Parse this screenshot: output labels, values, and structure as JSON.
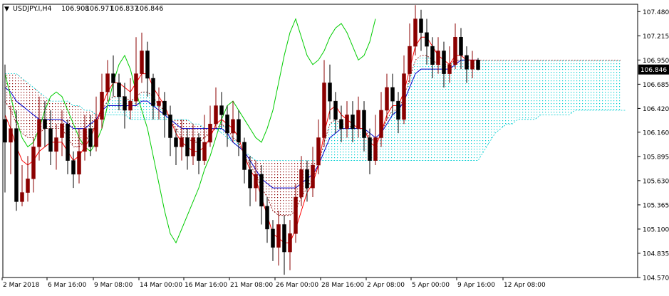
{
  "header": {
    "symbol": "USDJPY.I,H4",
    "open": "106.908",
    "high": "106.971",
    "low": "106.837",
    "close": "106.846"
  },
  "chart_data": {
    "type": "candlestick",
    "title": "USDJPY.I,H4",
    "ylim": [
      104.57,
      107.56
    ],
    "y_ticks": [
      "107.480",
      "107.215",
      "106.950",
      "106.685",
      "106.420",
      "106.160",
      "105.895",
      "105.630",
      "105.365",
      "105.100",
      "104.835",
      "104.570"
    ],
    "x_ticks": [
      "2 Mar 2018",
      "6 Mar 16:00",
      "9 Mar 08:00",
      "14 Mar 00:00",
      "16 Mar 16:00",
      "21 Mar 08:00",
      "26 Mar 00:00",
      "28 Mar 16:00",
      "2 Apr 08:00",
      "5 Apr 00:00",
      "9 Apr 16:00",
      "12 Apr 08:00"
    ],
    "current_price": "106.846",
    "colors": {
      "bull": "#8b0000",
      "bear": "#000000",
      "tenkan": "#ff0000",
      "kijun": "#0000cd",
      "chikou": "#00cc00",
      "kumo_bear": "#8b0000",
      "kumo_bull": "#00ced1"
    },
    "candles": [
      [
        106.3,
        106.05,
        106.9,
        105.5
      ],
      [
        106.05,
        106.2,
        106.45,
        105.7
      ],
      [
        106.2,
        105.4,
        106.4,
        105.3
      ],
      [
        105.4,
        105.5,
        105.8,
        105.35
      ],
      [
        105.5,
        105.65,
        105.9,
        105.4
      ],
      [
        105.65,
        106.0,
        106.1,
        105.5
      ],
      [
        106.0,
        106.3,
        106.55,
        105.85
      ],
      [
        106.3,
        106.2,
        106.5,
        106.0
      ],
      [
        106.2,
        105.95,
        106.4,
        105.8
      ],
      [
        105.95,
        106.1,
        106.25,
        105.75
      ],
      [
        106.1,
        106.25,
        106.4,
        105.9
      ],
      [
        106.25,
        105.85,
        106.3,
        105.7
      ],
      [
        105.85,
        105.7,
        105.95,
        105.55
      ],
      [
        105.7,
        105.95,
        106.2,
        105.6
      ],
      [
        105.95,
        106.2,
        106.35,
        105.85
      ],
      [
        106.2,
        106.0,
        106.35,
        105.9
      ],
      [
        106.0,
        106.3,
        106.55,
        105.95
      ],
      [
        106.3,
        106.6,
        106.8,
        106.2
      ],
      [
        106.6,
        106.8,
        106.95,
        106.5
      ],
      [
        106.8,
        106.7,
        107.0,
        106.55
      ],
      [
        106.7,
        106.55,
        106.8,
        106.4
      ],
      [
        106.55,
        106.4,
        106.7,
        106.2
      ],
      [
        106.4,
        106.5,
        106.75,
        106.3
      ],
      [
        106.5,
        106.8,
        107.2,
        106.45
      ],
      [
        106.8,
        107.05,
        107.25,
        106.7
      ],
      [
        107.05,
        106.75,
        107.15,
        106.55
      ],
      [
        106.75,
        106.45,
        106.8,
        106.3
      ],
      [
        106.45,
        106.5,
        106.65,
        106.3
      ],
      [
        106.5,
        106.35,
        106.6,
        106.1
      ],
      [
        106.35,
        106.1,
        106.45,
        105.9
      ],
      [
        106.1,
        106.0,
        106.2,
        105.8
      ],
      [
        106.0,
        106.1,
        106.3,
        105.85
      ],
      [
        106.1,
        105.9,
        106.2,
        105.75
      ],
      [
        105.9,
        106.1,
        106.25,
        105.8
      ],
      [
        106.1,
        105.85,
        106.15,
        105.7
      ],
      [
        105.85,
        106.05,
        106.35,
        105.8
      ],
      [
        106.05,
        106.25,
        106.45,
        106.0
      ],
      [
        106.25,
        106.45,
        106.65,
        106.2
      ],
      [
        106.45,
        106.35,
        106.6,
        106.2
      ],
      [
        106.35,
        106.15,
        106.45,
        106.0
      ],
      [
        106.15,
        106.3,
        106.5,
        106.05
      ],
      [
        106.3,
        106.05,
        106.4,
        105.9
      ],
      [
        106.05,
        105.75,
        106.1,
        105.6
      ],
      [
        105.75,
        105.55,
        105.9,
        105.35
      ],
      [
        105.55,
        105.7,
        105.85,
        105.4
      ],
      [
        105.7,
        105.35,
        105.8,
        105.15
      ],
      [
        105.35,
        105.1,
        105.45,
        104.95
      ],
      [
        105.1,
        104.9,
        105.2,
        104.75
      ],
      [
        104.9,
        105.15,
        105.3,
        104.7
      ],
      [
        105.15,
        104.85,
        105.25,
        104.6
      ],
      [
        104.85,
        105.05,
        105.2,
        104.65
      ],
      [
        105.05,
        105.45,
        105.6,
        104.95
      ],
      [
        105.45,
        105.75,
        105.9,
        105.35
      ],
      [
        105.75,
        105.55,
        105.85,
        105.4
      ],
      [
        105.55,
        105.8,
        106.0,
        105.45
      ],
      [
        105.8,
        106.1,
        106.3,
        105.7
      ],
      [
        106.1,
        106.7,
        106.95,
        106.0
      ],
      [
        106.7,
        106.5,
        106.9,
        106.3
      ],
      [
        106.5,
        106.3,
        106.6,
        106.15
      ],
      [
        106.3,
        106.2,
        106.45,
        106.05
      ],
      [
        106.2,
        106.35,
        106.5,
        106.1
      ],
      [
        106.35,
        106.2,
        106.5,
        106.05
      ],
      [
        106.2,
        106.4,
        106.55,
        106.1
      ],
      [
        106.4,
        106.1,
        106.5,
        105.95
      ],
      [
        106.1,
        105.85,
        106.2,
        105.7
      ],
      [
        105.85,
        106.1,
        106.35,
        105.8
      ],
      [
        106.1,
        106.4,
        106.6,
        106.0
      ],
      [
        106.4,
        106.65,
        106.8,
        106.3
      ],
      [
        106.65,
        106.5,
        106.8,
        106.35
      ],
      [
        106.5,
        106.3,
        106.6,
        106.15
      ],
      [
        106.3,
        106.8,
        107.0,
        106.25
      ],
      [
        106.8,
        107.1,
        107.35,
        106.7
      ],
      [
        107.1,
        107.4,
        107.55,
        107.0
      ],
      [
        107.4,
        107.25,
        107.5,
        107.05
      ],
      [
        107.25,
        107.1,
        107.4,
        106.9
      ],
      [
        107.1,
        106.9,
        107.2,
        106.75
      ],
      [
        106.9,
        107.05,
        107.2,
        106.8
      ],
      [
        107.05,
        106.8,
        107.15,
        106.65
      ],
      [
        106.8,
        106.9,
        107.1,
        106.7
      ],
      [
        106.9,
        107.2,
        107.35,
        106.85
      ],
      [
        107.2,
        107.0,
        107.3,
        106.85
      ],
      [
        107.0,
        106.85,
        107.1,
        106.7
      ],
      [
        106.85,
        106.95,
        107.05,
        106.75
      ],
      [
        106.95,
        106.846,
        106.971,
        106.837
      ]
    ],
    "tenkan": [
      106.35,
      106.2,
      106.0,
      105.85,
      105.8,
      105.85,
      105.95,
      106.0,
      106.05,
      106.05,
      106.05,
      105.95,
      105.85,
      105.9,
      106.0,
      106.1,
      106.25,
      106.45,
      106.6,
      106.7,
      106.7,
      106.65,
      106.6,
      106.7,
      106.8,
      106.8,
      106.65,
      106.55,
      106.45,
      106.3,
      106.15,
      106.05,
      106.0,
      105.95,
      105.95,
      106.0,
      106.1,
      106.25,
      106.3,
      106.25,
      106.2,
      106.1,
      105.9,
      105.75,
      105.65,
      105.45,
      105.25,
      105.05,
      105.0,
      104.95,
      104.95,
      105.1,
      105.3,
      105.5,
      105.6,
      105.8,
      106.15,
      106.4,
      106.45,
      106.35,
      106.3,
      106.25,
      106.2,
      106.2,
      106.05,
      106.0,
      106.15,
      106.35,
      106.45,
      106.45,
      106.6,
      106.85,
      107.1,
      107.2,
      107.2,
      107.1,
      107.0,
      106.95,
      106.9,
      107.0,
      107.0,
      106.95,
      106.95,
      106.95
    ],
    "kijun": [
      106.65,
      106.6,
      106.5,
      106.45,
      106.4,
      106.35,
      106.3,
      106.3,
      106.3,
      106.3,
      106.3,
      106.25,
      106.2,
      106.2,
      106.2,
      106.25,
      106.3,
      106.4,
      106.45,
      106.45,
      106.45,
      106.45,
      106.45,
      106.45,
      106.5,
      106.5,
      106.45,
      106.4,
      106.35,
      106.3,
      106.25,
      106.2,
      106.2,
      106.2,
      106.2,
      106.2,
      106.2,
      106.2,
      106.2,
      106.15,
      106.05,
      106.0,
      105.95,
      105.85,
      105.75,
      105.65,
      105.6,
      105.55,
      105.55,
      105.55,
      105.55,
      105.55,
      105.6,
      105.65,
      105.7,
      105.8,
      105.95,
      106.1,
      106.15,
      106.2,
      106.2,
      106.2,
      106.2,
      106.2,
      106.15,
      106.1,
      106.15,
      106.25,
      106.35,
      106.4,
      106.5,
      106.65,
      106.8,
      106.85,
      106.85,
      106.85,
      106.85,
      106.85,
      106.85,
      106.9,
      106.95,
      106.95,
      106.95,
      106.95
    ],
    "chikou": [
      106.8,
      106.55,
      106.3,
      106.1,
      106.0,
      106.05,
      106.2,
      106.4,
      106.55,
      106.6,
      106.55,
      106.4,
      106.25,
      106.1,
      106.0,
      105.95,
      106.05,
      106.2,
      106.45,
      106.7,
      106.9,
      107.0,
      106.85,
      106.6,
      106.4,
      106.2,
      105.9,
      105.6,
      105.3,
      105.05,
      104.95,
      105.1,
      105.25,
      105.4,
      105.55,
      105.75,
      105.9,
      106.1,
      106.3,
      106.45,
      106.5,
      106.4,
      106.3,
      106.2,
      106.1,
      106.05,
      106.2,
      106.4,
      106.7,
      107.0,
      107.25,
      107.4,
      107.2,
      107.0,
      106.9,
      106.95,
      107.05,
      107.2,
      107.3,
      107.35,
      107.25,
      107.1,
      106.95,
      107.0,
      107.15,
      107.4
    ],
    "span_a": [
      106.5,
      106.4,
      106.25,
      106.15,
      106.1,
      106.1,
      106.15,
      106.2,
      106.2,
      106.2,
      106.2,
      106.1,
      106.0,
      106.0,
      106.05,
      106.15,
      106.25,
      106.4,
      106.5,
      106.55,
      106.55,
      106.55,
      106.5,
      106.55,
      106.6,
      106.6,
      106.55,
      106.45,
      106.4,
      106.3,
      106.2,
      106.1,
      106.1,
      106.05,
      106.05,
      106.1,
      106.15,
      106.2,
      106.25,
      106.2,
      106.1,
      106.05,
      105.9,
      105.8,
      105.7,
      105.55,
      105.45,
      105.3,
      105.25,
      105.25,
      105.25,
      105.3,
      105.45,
      105.55,
      105.65,
      105.8,
      106.05,
      106.25,
      106.3,
      106.25,
      106.25,
      106.2,
      106.2,
      106.2,
      106.1,
      106.05,
      106.15,
      106.3,
      106.4,
      106.4,
      106.55,
      106.75,
      106.95,
      107.0,
      107.0,
      106.95,
      106.9,
      106.9,
      106.9,
      106.95,
      106.95,
      106.95,
      106.95,
      106.95,
      106.95,
      106.95,
      106.95,
      106.95,
      106.95,
      106.95,
      106.95,
      106.95,
      106.95,
      106.95,
      106.95,
      106.95,
      106.95,
      106.95,
      106.95,
      106.95,
      106.95,
      106.95,
      106.95,
      106.95,
      106.95,
      106.95,
      106.95,
      106.95,
      106.95
    ],
    "span_b": [
      106.8,
      106.8,
      106.8,
      106.75,
      106.7,
      106.65,
      106.6,
      106.55,
      106.5,
      106.5,
      106.5,
      106.5,
      106.45,
      106.45,
      106.4,
      106.4,
      106.35,
      106.35,
      106.35,
      106.35,
      106.35,
      106.35,
      106.3,
      106.3,
      106.3,
      106.3,
      106.3,
      106.3,
      106.3,
      106.3,
      106.3,
      106.3,
      106.3,
      106.25,
      106.25,
      106.2,
      106.2,
      106.2,
      106.15,
      106.1,
      106.05,
      106.0,
      105.95,
      105.9,
      105.85,
      105.85,
      105.85,
      105.85,
      105.85,
      105.85,
      105.85,
      105.85,
      105.85,
      105.85,
      105.85,
      105.85,
      105.85,
      105.85,
      105.85,
      105.85,
      105.85,
      105.85,
      105.85,
      105.85,
      105.85,
      105.85,
      105.85,
      105.85,
      105.85,
      105.85,
      105.85,
      105.85,
      105.85,
      105.85,
      105.85,
      105.85,
      105.85,
      105.85,
      105.85,
      105.85,
      105.85,
      105.85,
      105.85,
      105.85,
      105.95,
      106.05,
      106.15,
      106.2,
      106.25,
      106.25,
      106.3,
      106.3,
      106.3,
      106.3,
      106.35,
      106.35,
      106.35,
      106.35,
      106.35,
      106.35,
      106.4,
      106.4,
      106.4,
      106.4,
      106.4,
      106.4,
      106.4,
      106.4,
      106.4,
      106.4
    ]
  }
}
